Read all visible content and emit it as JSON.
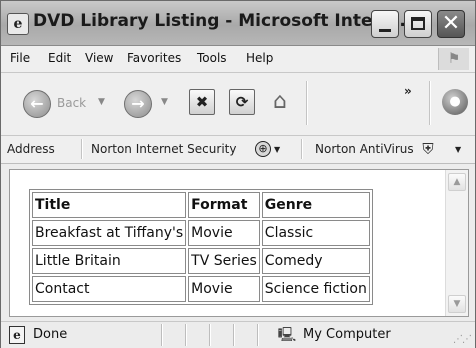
{
  "window": {
    "title": "DVD Library Listing - Microsoft Intern...",
    "app_icon": "ie-icon"
  },
  "menu": {
    "items": [
      "File",
      "Edit",
      "View",
      "Favorites",
      "Tools",
      "Help"
    ],
    "logo_icon": "windows-flag-icon"
  },
  "toolbar": {
    "back_label": "Back",
    "chevron": "»"
  },
  "address_bar": {
    "label": "Address",
    "norton_internet_security": "Norton Internet Security",
    "norton_antivirus": "Norton AntiVirus"
  },
  "table": {
    "headers": [
      "Title",
      "Format",
      "Genre"
    ],
    "rows": [
      [
        "Breakfast at Tiffany's",
        "Movie",
        "Classic"
      ],
      [
        "Little Britain",
        "TV Series",
        "Comedy"
      ],
      [
        "Contact",
        "Movie",
        "Science fiction"
      ]
    ]
  },
  "status": {
    "text": "Done",
    "zone": "My Computer"
  }
}
